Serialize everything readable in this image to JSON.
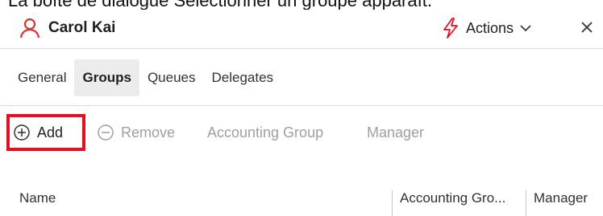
{
  "caption": {
    "text": "La boîte de dialogue Sélectionner un groupe apparaît."
  },
  "header": {
    "user_name": "Carol Kai",
    "actions_label": "Actions"
  },
  "tabs": [
    {
      "label": "General"
    },
    {
      "label": "Groups",
      "active": true
    },
    {
      "label": "Queues"
    },
    {
      "label": "Delegates"
    }
  ],
  "toolbar": {
    "add_label": "Add",
    "remove_label": "Remove",
    "accounting_group_label": "Accounting Group",
    "manager_label": "Manager"
  },
  "table": {
    "columns": [
      {
        "label": "Name"
      },
      {
        "label": "Accounting Gro..."
      },
      {
        "label": "Manager"
      }
    ]
  },
  "colors": {
    "accent_red": "#e3101f",
    "user_icon": "#d13438",
    "tab_active_bg": "#ebebeb",
    "disabled_text": "#a19f9d"
  },
  "icons": [
    "user-icon",
    "lightning-icon",
    "chevron-down-icon",
    "close-icon",
    "add-circle-icon",
    "remove-circle-icon"
  ]
}
